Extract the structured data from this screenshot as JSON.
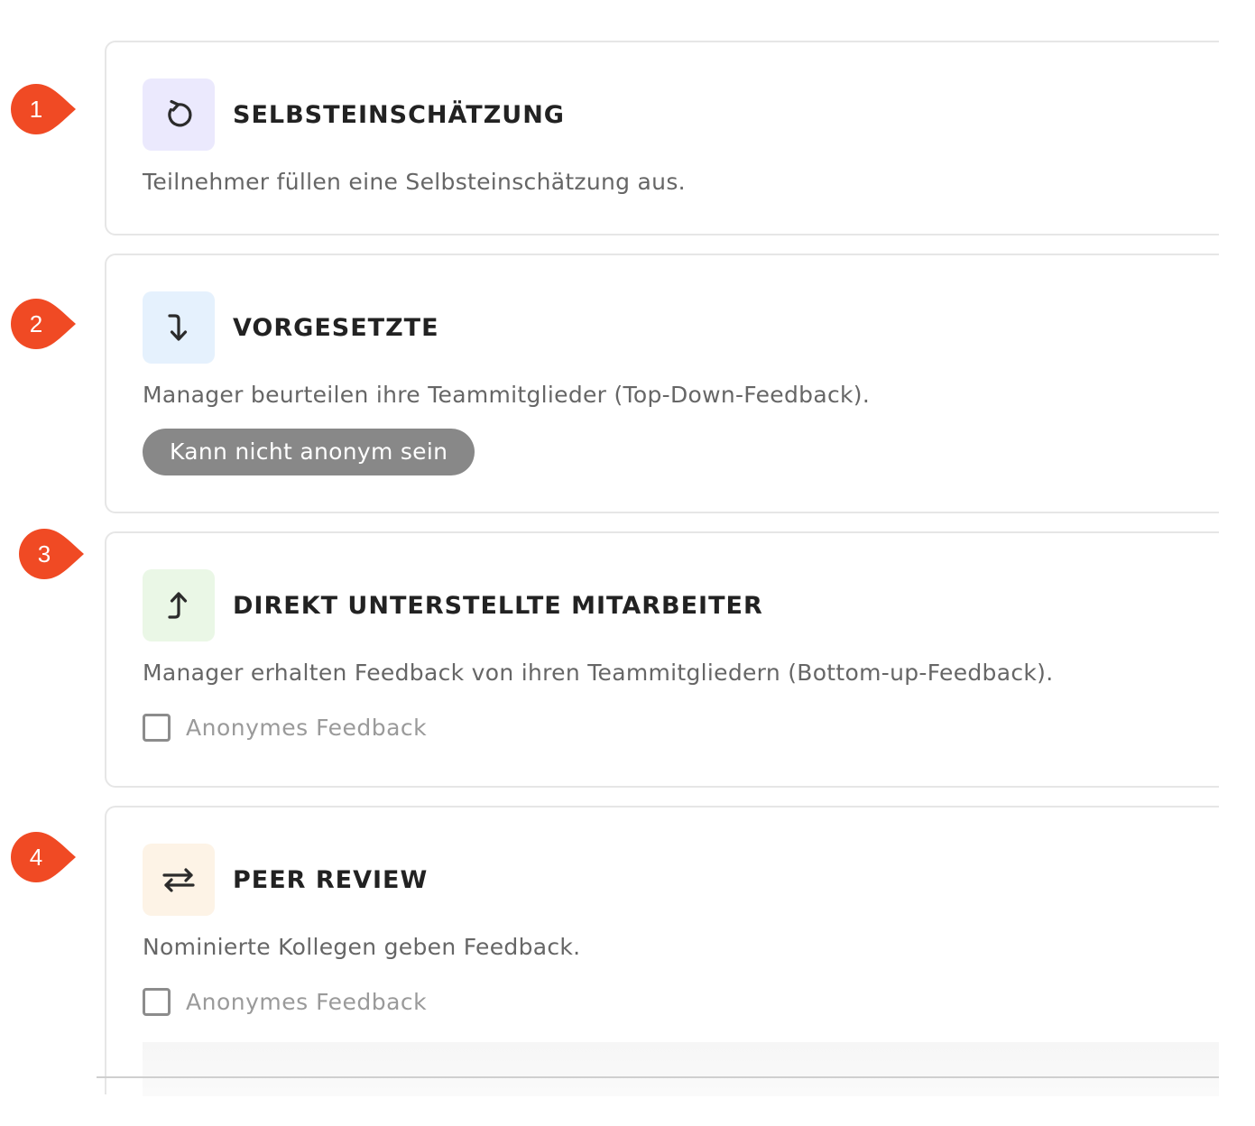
{
  "sections": [
    {
      "number": "1",
      "title": "SELBSTEINSCHÄTZUNG",
      "description": "Teilnehmer füllen eine Selbsteinschätzung aus.",
      "icon": "rotate-ccw-icon",
      "tile_color": "#ebe9fd"
    },
    {
      "number": "2",
      "title": "VORGESETZTE",
      "description": "Manager beurteilen ihre Teammitglieder (Top-Down-Feedback).",
      "icon": "arrow-down-icon",
      "tile_color": "#e5f1fd",
      "badge": "Kann nicht anonym sein"
    },
    {
      "number": "3",
      "title": "DIREKT UNTERSTELLTE MITARBEITER",
      "description": "Manager erhalten Feedback von ihren Teammitgliedern (Bottom-up-Feedback).",
      "icon": "arrow-up-icon",
      "tile_color": "#eaf7e6",
      "checkbox_label": "Anonymes Feedback",
      "checked": false
    },
    {
      "number": "4",
      "title": "PEER REVIEW",
      "description": "Nominierte Kollegen geben Feedback.",
      "icon": "swap-arrows-icon",
      "tile_color": "#fdf3e6",
      "checkbox_label": "Anonymes Feedback",
      "checked": false
    }
  ],
  "colors": {
    "marker": "#f04a24",
    "badge_bg": "#888888",
    "border": "#e6e6e6"
  }
}
